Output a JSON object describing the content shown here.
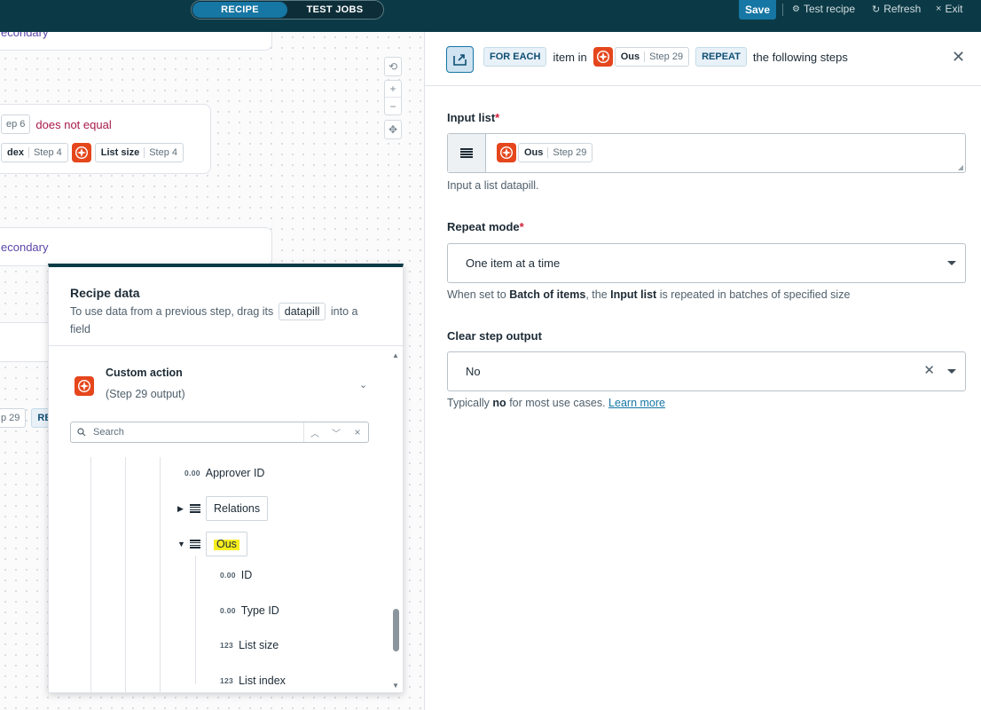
{
  "topbar": {
    "tabs": [
      "RECIPE",
      "TEST JOBS"
    ],
    "save": "Save",
    "test_recipe": "Test recipe",
    "refresh": "Refresh",
    "exit": "Exit"
  },
  "canvas": {
    "card1_text": "econdary",
    "cond_step": "ep 6",
    "cond_op": "does not equal",
    "pill_index": "dex",
    "pill_index_step": "Step 4",
    "pill_listsize": "List size",
    "pill_listsize_step": "Step 4",
    "card3_text": "econdary",
    "pill_29": "p 29",
    "pill_re": "RE"
  },
  "recipe_data": {
    "title": "Recipe data",
    "sub_before": "To use data from a previous step, drag its",
    "datapill": "datapill",
    "sub_after": "into a field",
    "action_title": "Custom action",
    "action_sub": "(Step 29 output)",
    "search_placeholder": "Search",
    "tree": [
      {
        "type": "0.00",
        "label": "Approver ID"
      },
      {
        "label": "Relations"
      },
      {
        "label": "Ous"
      },
      {
        "type": "0.00",
        "label": "ID"
      },
      {
        "type": "0.00",
        "label": "Type ID"
      },
      {
        "type": "123",
        "label": "List size"
      },
      {
        "type": "123",
        "label": "List index"
      }
    ]
  },
  "panel": {
    "for_each": "FOR EACH",
    "item_in": "item in",
    "pill_name": "Ous",
    "pill_step": "Step 29",
    "repeat": "REPEAT",
    "following": "the following steps",
    "input_list_label": "Input list",
    "input_list_hint": "Input a list datapill.",
    "repeat_mode_label": "Repeat mode",
    "repeat_mode_value": "One item at a time",
    "repeat_hint_1": "When set to",
    "repeat_hint_b1": "Batch of items",
    "repeat_hint_2": ", the",
    "repeat_hint_b2": "Input list",
    "repeat_hint_3": "is repeated in batches of specified size",
    "clear_label": "Clear step output",
    "clear_value": "No",
    "clear_hint_1": "Typically",
    "clear_hint_b": "no",
    "clear_hint_2": "for most use cases.",
    "learn_more": "Learn more"
  },
  "colors": {
    "topbar": "#0b3a46",
    "accent": "#1676a4",
    "logo": "#e5461c",
    "highlight": "#f7ee1e",
    "required": "#d11f3a"
  }
}
